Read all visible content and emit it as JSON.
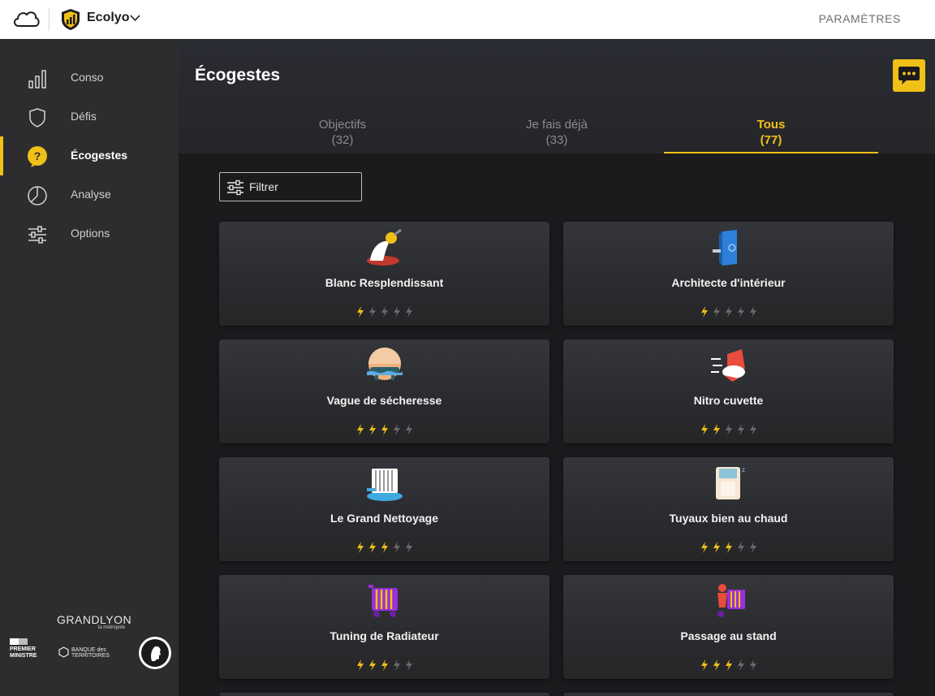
{
  "topbar": {
    "app_name": "Ecolyo",
    "settings_label": "PARAMÈTRES"
  },
  "sidebar": {
    "items": [
      {
        "label": "Conso",
        "icon": "bar-chart-icon",
        "active": false
      },
      {
        "label": "Défis",
        "icon": "shield-icon",
        "active": false
      },
      {
        "label": "Écogestes",
        "icon": "lightbulb-question-icon",
        "active": true
      },
      {
        "label": "Analyse",
        "icon": "pie-chart-icon",
        "active": false
      },
      {
        "label": "Options",
        "icon": "sliders-icon",
        "active": false
      }
    ],
    "partners": {
      "grandlyon": "GRANDLYON",
      "grandlyon_sub": "la métropole",
      "premier_ministre": "PREMIER MINISTRE",
      "banque_territoires": "BANQUE des TERRITOIRES"
    }
  },
  "main": {
    "page_title": "Écogestes",
    "tabs": [
      {
        "label": "Objectifs",
        "count": "(32)",
        "active": false
      },
      {
        "label": "Je fais déjà",
        "count": "(33)",
        "active": false
      },
      {
        "label": "Tous",
        "count": "(77)",
        "active": true
      }
    ],
    "filter_label": "Filtrer",
    "cards": [
      {
        "title": "Blanc Resplendissant",
        "rating": 1,
        "max_rating": 5,
        "icon": "washing-figure-icon"
      },
      {
        "title": "Architecte d'intérieur",
        "rating": 1,
        "max_rating": 5,
        "icon": "blue-door-icon"
      },
      {
        "title": "Vague de sécheresse",
        "rating": 3,
        "max_rating": 5,
        "icon": "bathtub-sunset-icon"
      },
      {
        "title": "Nitro cuvette",
        "rating": 2,
        "max_rating": 5,
        "icon": "red-toilet-speed-icon"
      },
      {
        "title": "Le Grand Nettoyage",
        "rating": 3,
        "max_rating": 5,
        "icon": "radiator-cleaning-icon"
      },
      {
        "title": "Tuyaux bien au chaud",
        "rating": 3,
        "max_rating": 5,
        "icon": "pipe-insulation-icon"
      },
      {
        "title": "Tuning de Radiateur",
        "rating": 3,
        "max_rating": 5,
        "icon": "purple-radiator-icon"
      },
      {
        "title": "Passage au stand",
        "rating": 3,
        "max_rating": 5,
        "icon": "radiator-stand-icon"
      }
    ]
  },
  "colors": {
    "accent": "#f1c017",
    "sidebar_bg": "#2d2d30",
    "main_bg": "#1b1b1e",
    "card_bg": "#2f3034",
    "bolt_inactive": "#6a6a6e"
  }
}
